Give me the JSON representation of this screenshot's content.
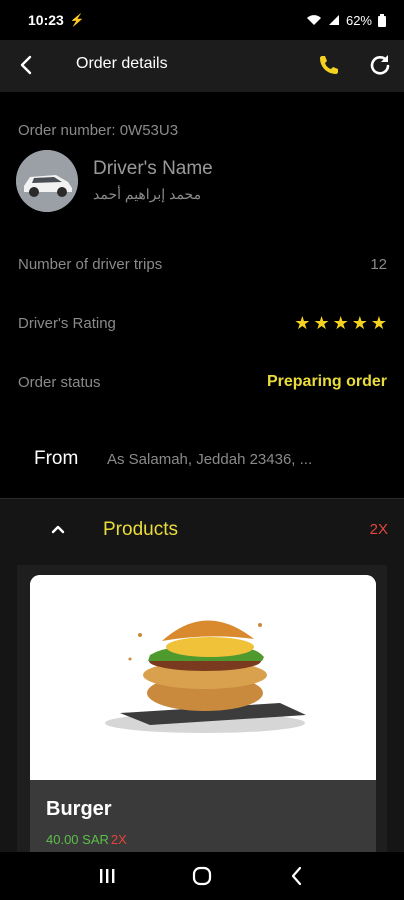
{
  "status_bar": {
    "time": "10:23",
    "battery": "62%"
  },
  "app_bar": {
    "title": "Order details",
    "icons": [
      "back-arrow-icon",
      "phone-icon",
      "refresh-icon"
    ]
  },
  "order": {
    "number_label": "Order number: 0W53U3"
  },
  "driver": {
    "name": "Driver's Name",
    "name_ar": "محمد إبراهيم أحمد",
    "trips_label": "Number of driver trips",
    "trips_value": "12",
    "rating_label": "Driver's Rating",
    "rating_stars": 5,
    "status_label": "Order status",
    "status_value": "Preparing order"
  },
  "route": {
    "from_label": "From",
    "from_address": "As Salamah, Jeddah 23436, ..."
  },
  "products": {
    "title": "Products",
    "count": "2X",
    "items": [
      {
        "name": "Burger",
        "price": "40.00 SAR",
        "qty": "2X"
      }
    ]
  },
  "colors": {
    "accent_yellow": "#e9dc3b",
    "star_yellow": "#f4d21f",
    "price_green": "#5cbf4a",
    "qty_red": "#e0463a",
    "app_bar_bg": "#1c1c1c"
  }
}
